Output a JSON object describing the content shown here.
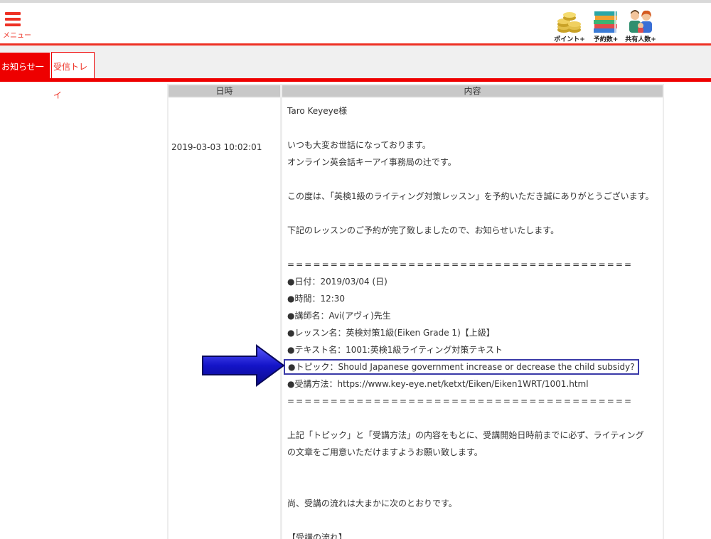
{
  "header": {
    "menu_label": "メニュー",
    "icons": [
      {
        "name": "coins-icon",
        "label": "ポイント+"
      },
      {
        "name": "books-icon",
        "label": "予約数+"
      },
      {
        "name": "people-icon",
        "label": "共有人数+"
      }
    ],
    "accent_color": "#ee3124"
  },
  "tabs": [
    {
      "label": "お知らせ一覧",
      "active": true
    },
    {
      "label": "受信トレイ",
      "active": false
    }
  ],
  "table": {
    "headers": {
      "date": "日時",
      "content": "内容"
    },
    "row": {
      "date": "2019-03-03 10:02:01",
      "lines": [
        "Taro Keyeye様",
        "",
        "いつも大変お世話になっております。",
        "オンライン英会話キーアイ事務局の辻です。",
        "",
        "この度は、「英検1級のライティング対策レッスン」を予約いただき誠にありがとうございます。",
        "",
        "下記のレッスンのご予約が完了致しましたので、お知らせいたします。",
        "",
        "========================================",
        "●日付：2019/03/04 (日)",
        "●時間：12:30",
        "●講師名：Avi(アヴィ)先生",
        "●レッスン名：英検対策1級(Eiken Grade 1)【上級】",
        "●テキスト名：1001:英検1級ライティング対策テキスト",
        "●トピック：Should Japanese government increase or decrease the child subsidy?",
        "●受講方法：https://www.key-eye.net/ketxt/Eiken/Eiken1WRT/1001.html",
        "========================================",
        "",
        "上記「トピック」と「受講方法」の内容をもとに、受講開始日時前までに必ず、ライティング",
        "の文章をご用意いただけますようお願い致します。",
        "",
        "",
        "尚、受講の流れは大まかに次のとおりです。",
        "",
        "【受講の流れ】"
      ]
    }
  }
}
